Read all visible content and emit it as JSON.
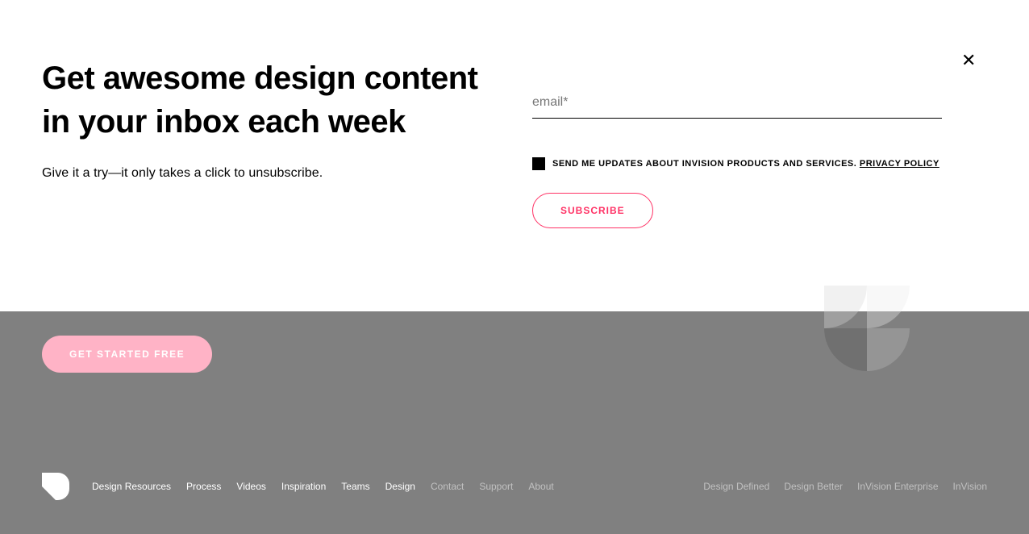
{
  "modal": {
    "heading": "Get awesome design content in your inbox each week",
    "subtext": "Give it a try—it only takes a click to unsubscribe.",
    "email_placeholder": "email*",
    "consent_text": "SEND ME UPDATES ABOUT INVISION PRODUCTS AND SERVICES.",
    "privacy_label": "PRIVACY POLICY",
    "subscribe_label": "SUBSCRIBE",
    "close_glyph": "✕"
  },
  "cta": {
    "get_started_label": "GET STARTED FREE"
  },
  "footer": {
    "nav_primary": {
      "0": "Design Resources",
      "1": "Process",
      "2": "Videos",
      "3": "Inspiration",
      "4": "Teams",
      "5": "Design"
    },
    "nav_muted": {
      "0": "Contact",
      "1": "Support",
      "2": "About"
    },
    "nav_right": {
      "0": "Design Defined",
      "1": "Design Better",
      "2": "InVision Enterprise",
      "3": "InVision"
    }
  }
}
